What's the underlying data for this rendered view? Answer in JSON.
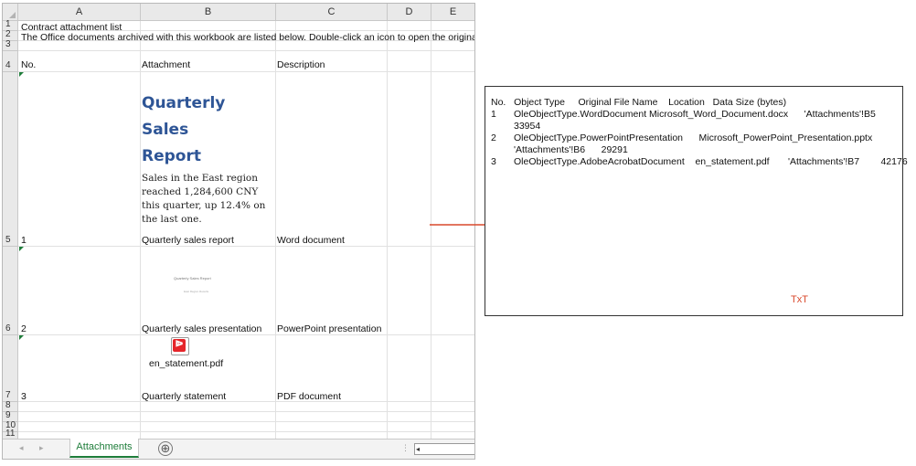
{
  "sheet": {
    "columns": [
      "A",
      "B",
      "C",
      "D",
      "E"
    ],
    "rows": [
      "1",
      "2",
      "3",
      "4",
      "5",
      "6",
      "7",
      "8",
      "9",
      "10",
      "11"
    ],
    "row1_a": "Contract attachment list",
    "row2_a": "The Office documents archived with this workbook are listed below. Double-click an icon to open the original file.",
    "headers": {
      "no": "No.",
      "attachment": "Attachment",
      "description": "Description"
    },
    "items": [
      {
        "no": "1",
        "attachment": "Quarterly sales report",
        "description": "Word document"
      },
      {
        "no": "2",
        "attachment": "Quarterly sales presentation",
        "description": "PowerPoint presentation"
      },
      {
        "no": "3",
        "attachment": "Quarterly statement",
        "description": "PDF document"
      }
    ],
    "word_preview": {
      "title_line1": "Quarterly Sales",
      "title_line2": "Report",
      "body": "Sales in the East region reached 1,284,600 CNY this quarter, up 12.4% on the last one."
    },
    "ppt_preview": {
      "title": "Quarterly Sales Report",
      "subtitle": "East Region Results"
    },
    "pdf_icon": {
      "filename": "en_statement.pdf",
      "icon": "pdf-file-icon",
      "color": "#e5252a"
    },
    "tab": {
      "active": "Attachments",
      "add_icon": "⊕",
      "dots": "⋮",
      "scroll_left": "◂"
    },
    "accent": "#1e7d3a"
  },
  "panel": {
    "header": "No.   Object Type     Original File Name    Location   Data Size (bytes)",
    "lines": [
      {
        "no": "1",
        "text": "OleObjectType.WordDocument Microsoft_Word_Document.docx      'Attachments'!B5",
        "cont": "33954"
      },
      {
        "no": "2",
        "text": "OleObjectType.PowerPointPresentation      Microsoft_PowerPoint_Presentation.pptx",
        "cont": "'Attachments'!B6      29291"
      },
      {
        "no": "3",
        "text": "OleObjectType.AdobeAcrobatDocument    en_statement.pdf       'Attachments'!B7        42176",
        "cont": ""
      }
    ],
    "label": "TxT",
    "label_color": "#d9482b"
  },
  "arrow_color": "#d9482b"
}
